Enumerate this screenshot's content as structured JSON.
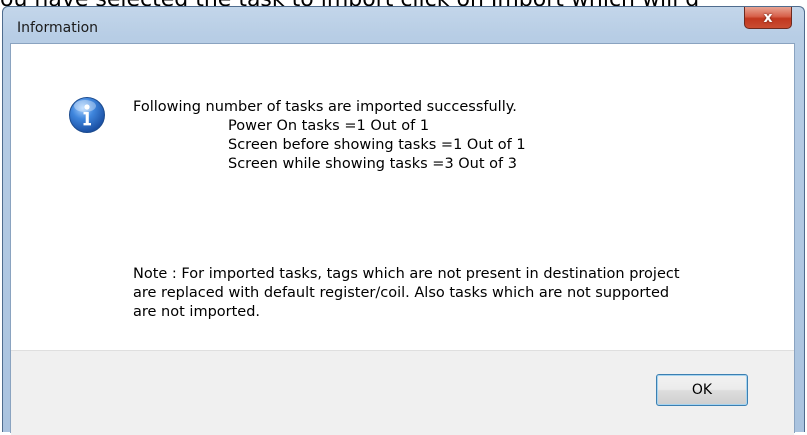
{
  "background": {
    "text": "ou have selected the task to import click on Import which will d"
  },
  "window": {
    "title": "Information",
    "close_label": "x"
  },
  "message": {
    "line1": "Following number of tasks are imported successfully.",
    "line2": "Power On tasks =1 Out of 1",
    "line3": "Screen before showing tasks =1 Out of 1",
    "line4": "Screen while showing tasks =3 Out of 3"
  },
  "note": {
    "text": "Note : For imported tasks, tags which are not present in destination project are replaced with default register/coil. Also tasks which are not supported are not imported."
  },
  "buttons": {
    "ok_label": "OK"
  },
  "icons": {
    "info": "info-icon",
    "close": "close-icon"
  }
}
